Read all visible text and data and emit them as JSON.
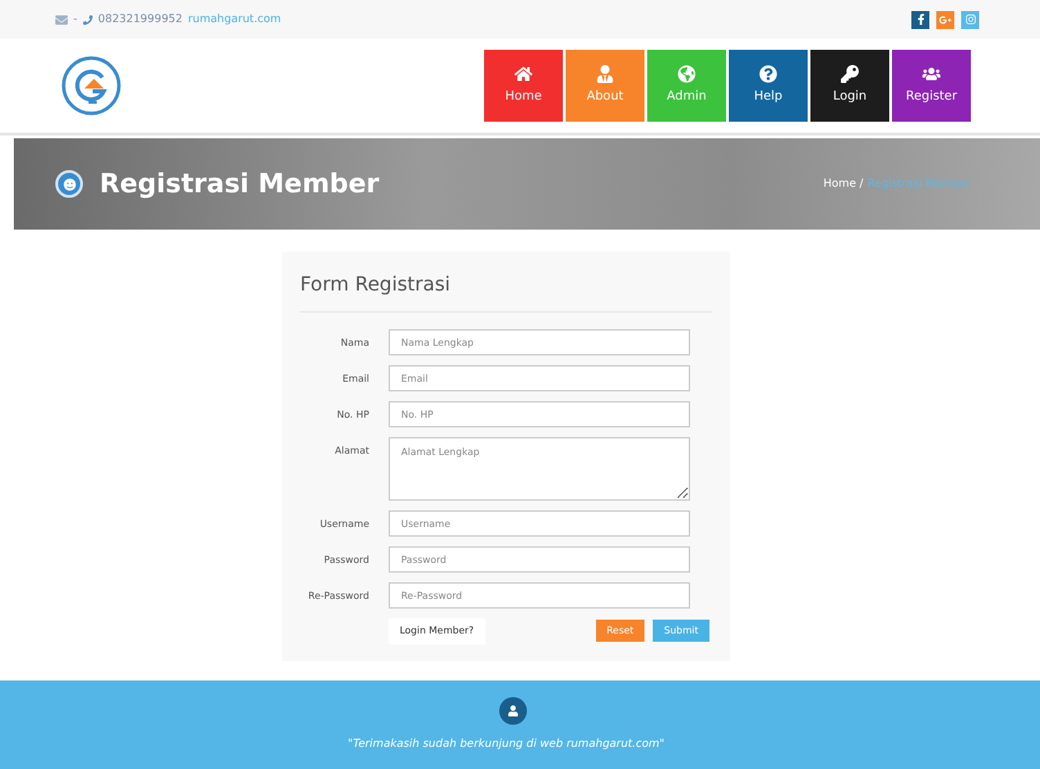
{
  "top_bar": {
    "separator": "-",
    "phone": "082321999952",
    "email": "rumahgarut.com"
  },
  "nav": [
    {
      "label": "Home",
      "color": "#f22f2f"
    },
    {
      "label": "About",
      "color": "#f7842a"
    },
    {
      "label": "Admin",
      "color": "#3cc23c"
    },
    {
      "label": "Help",
      "color": "#14679e"
    },
    {
      "label": "Login",
      "color": "#1d1d1d"
    },
    {
      "label": "Register",
      "color": "#8d24b4"
    }
  ],
  "banner": {
    "title": "Registrasi Member",
    "breadcrumb": [
      {
        "label": "Home /"
      },
      {
        "label": "Registrasi Member"
      }
    ]
  },
  "form": {
    "title": "Form Registrasi",
    "fields": [
      {
        "label": "Nama",
        "placeholder": "Nama Lengkap",
        "kind": "input"
      },
      {
        "label": "Email",
        "placeholder": "Email",
        "kind": "input"
      },
      {
        "label": "No. HP",
        "placeholder": "No. HP",
        "kind": "input"
      },
      {
        "label": "Alamat",
        "placeholder": "Alamat Lengkap",
        "kind": "textarea"
      },
      {
        "label": "Username",
        "placeholder": "Username",
        "kind": "input"
      },
      {
        "label": "Password",
        "placeholder": "Password",
        "kind": "input"
      },
      {
        "label": "Re-Password",
        "placeholder": "Re-Password",
        "kind": "input"
      }
    ],
    "login_link": "Login Member?",
    "buttons": [
      {
        "label": "Reset",
        "color": "#f7842a"
      },
      {
        "label": "Submit",
        "color": "#4ab3e6"
      }
    ]
  },
  "footer": {
    "quote": "\"Terimakasih sudah berkunjung di web rumahgarut.com\""
  }
}
